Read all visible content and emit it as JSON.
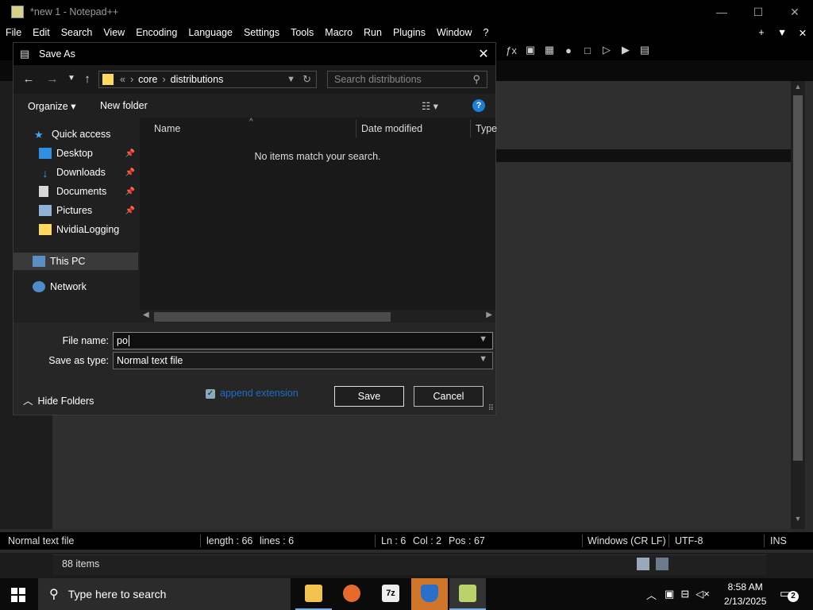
{
  "notepad": {
    "title": "*new 1 - Notepad++",
    "menu": [
      "File",
      "Edit",
      "Search",
      "View",
      "Encoding",
      "Language",
      "Settings",
      "Tools",
      "Macro",
      "Run",
      "Plugins",
      "Window",
      "?"
    ],
    "menu_right": [
      "+",
      "▼",
      "✕"
    ],
    "status": {
      "type": "Normal text file",
      "length": "length : 66",
      "lines": "lines : 6",
      "ln": "Ln : 6",
      "col": "Col : 2",
      "pos": "Pos : 67",
      "eol": "Windows (CR LF)",
      "enc": "UTF-8",
      "mode": "INS"
    }
  },
  "explorer_strip": {
    "count": "88 items"
  },
  "dialog": {
    "title": "Save As",
    "path": [
      "«",
      "core",
      "distributions"
    ],
    "search_placeholder": "Search distributions",
    "organize": "Organize ▾",
    "new_folder": "New folder",
    "columns": [
      "Name",
      "Date modified",
      "Type"
    ],
    "empty_message": "No items match your search.",
    "nav_items": [
      {
        "label": "Quick access",
        "icon": "star-icon"
      },
      {
        "label": "Desktop",
        "icon": "desktop-icon",
        "pinned": true
      },
      {
        "label": "Downloads",
        "icon": "download-icon",
        "pinned": true
      },
      {
        "label": "Documents",
        "icon": "document-icon",
        "pinned": true
      },
      {
        "label": "Pictures",
        "icon": "pictures-icon",
        "pinned": true
      },
      {
        "label": "NvidiaLogging",
        "icon": "folder-icon"
      },
      {
        "label": "This PC",
        "icon": "computer-icon"
      },
      {
        "label": "Network",
        "icon": "network-icon"
      }
    ],
    "file_name_label": "File name:",
    "file_name_value": "po",
    "save_type_label": "Save as type:",
    "save_type_value": "Normal text file",
    "hide_folders": "Hide Folders",
    "append_ext": "append extension",
    "save": "Save",
    "cancel": "Cancel"
  },
  "taskbar": {
    "search_placeholder": "Type here to search",
    "time": "8:58 AM",
    "date": "2/13/2025",
    "notifications": "2"
  },
  "colors": {
    "accent": "#1e7fd9",
    "folder": "#ffd85e",
    "link": "#1e6ec8"
  }
}
